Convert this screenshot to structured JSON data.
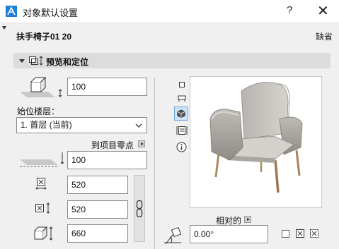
{
  "window": {
    "title": "对象默认设置",
    "help_label": "?",
    "close_label": "✕"
  },
  "object": {
    "name": "扶手椅子01 20",
    "default_label": "缺省"
  },
  "section": {
    "title": "预览和定位"
  },
  "fields": {
    "elevation": "100",
    "home_story_label": "始位楼层：",
    "home_story_value": "1. 首层 (当前)",
    "to_project_zero_label": "到项目零点",
    "project_zero_elevation": "100",
    "width": "520",
    "depth": "520",
    "height": "660",
    "relative_label": "相对的",
    "rotation": "0.00°"
  },
  "preview_tools": [
    "square-view-icon",
    "plan-view-icon",
    "3d-view-icon",
    "section-view-icon",
    "info-icon"
  ],
  "colors": {
    "accent": "#1e7fd6",
    "section_bg": "#dcdcdc",
    "panel_bg": "#f0f0f0"
  }
}
